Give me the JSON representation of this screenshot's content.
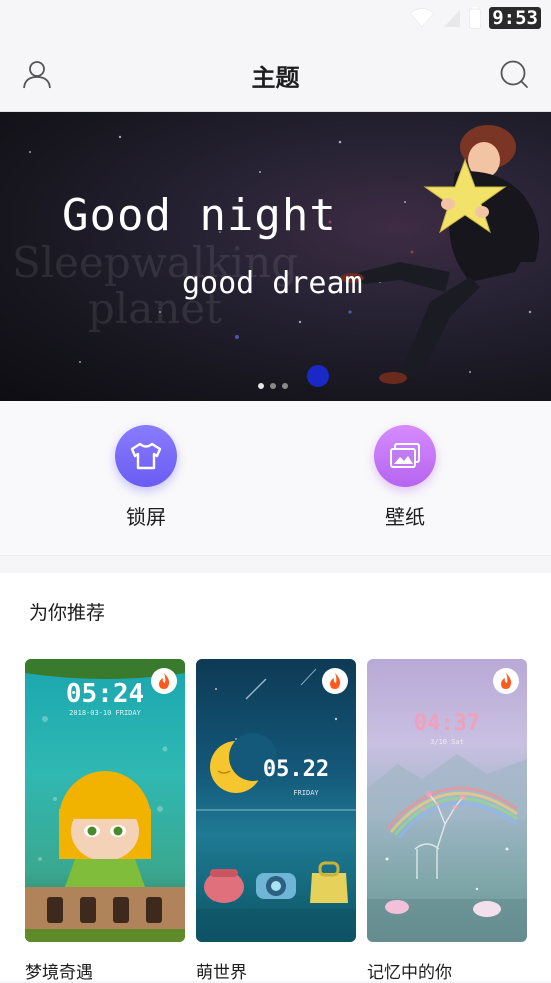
{
  "status": {
    "time": "9:53"
  },
  "header": {
    "title": "主题"
  },
  "banner": {
    "headline": "Good night",
    "subline": "good dream",
    "watermark_line1": "Sleepwalking",
    "watermark_line2": "planet"
  },
  "shortcuts": [
    {
      "label": "锁屏",
      "icon": "tshirt-icon"
    },
    {
      "label": "壁纸",
      "icon": "picture-icon"
    }
  ],
  "recommend": {
    "title": "为你推荐",
    "items": [
      {
        "name": "梦境奇遇",
        "clock": "05:24",
        "date": "2018-03-10  FRIDAY"
      },
      {
        "name": "萌世界",
        "clock": "05.22",
        "date": "FRIDAY"
      },
      {
        "name": "记忆中的你",
        "clock": "04:37",
        "date": "3/10  Sat"
      }
    ]
  },
  "colors": {
    "lock_accent": "#6a5cf2",
    "wallpaper_accent": "#b565ef",
    "hot_badge": "#ff5a1e"
  }
}
